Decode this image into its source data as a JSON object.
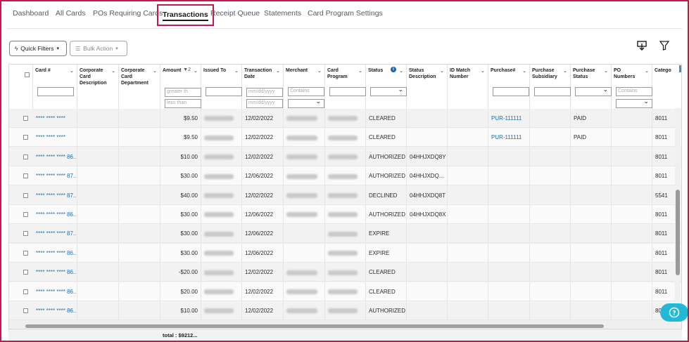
{
  "nav": {
    "tabs": [
      {
        "label": "Dashboard"
      },
      {
        "label": "All Cards"
      },
      {
        "label": "POs Requiring Cards"
      },
      {
        "label": "Transactions"
      },
      {
        "label": "Receipt Queue"
      },
      {
        "label": "Statements"
      },
      {
        "label": "Card Program Settings"
      }
    ],
    "active": "Transactions"
  },
  "toolbar": {
    "quick_filters": "Quick Filters",
    "bulk_action": "Bulk Action",
    "download_icon": "download-icon",
    "filter_icon": "filter-funnel-icon"
  },
  "columns": [
    {
      "label": "Card #",
      "filter": ""
    },
    {
      "label": "Corporate Card Description",
      "filter": ""
    },
    {
      "label": "Corporate Card Department",
      "filter": ""
    },
    {
      "label": "Amount",
      "filter_1": "greater th",
      "filter_2": "less than",
      "sort": "▼2"
    },
    {
      "label": "Issued To",
      "filter": ""
    },
    {
      "label": "Transaction Date",
      "filter_1": "mm/dd/yyyy",
      "filter_2": "mm/dd/yyyy"
    },
    {
      "label": "Merchant",
      "filter": "Contains"
    },
    {
      "label": "Card Program",
      "filter": ""
    },
    {
      "label": "Status",
      "filter": ""
    },
    {
      "label": "Status Description",
      "filter": ""
    },
    {
      "label": "ID Match Number",
      "filter": ""
    },
    {
      "label": "Purchase#",
      "filter": ""
    },
    {
      "label": "Purchase Subsidiary",
      "filter": ""
    },
    {
      "label": "Purchase Status",
      "filter": ""
    },
    {
      "label": "PO Numbers",
      "filter": "Contains"
    },
    {
      "label": "Catego",
      "filter": ""
    }
  ],
  "rows": [
    {
      "card": "**** **** ****",
      "amount": "$9.50",
      "date": "12/02/2022",
      "status": "CLEARED",
      "status_desc": "",
      "purchase": "PUR-111111",
      "purchase_status": "PAID",
      "category": "8011",
      "merchant": true
    },
    {
      "card": "**** **** ****",
      "amount": "$9.50",
      "date": "12/02/2022",
      "status": "CLEARED",
      "status_desc": "",
      "purchase": "PUR-111111",
      "purchase_status": "PAID",
      "category": "8011",
      "merchant": true
    },
    {
      "card": "**** **** **** 86...",
      "amount": "$10.00",
      "date": "12/02/2022",
      "status": "AUTHORIZED",
      "status_desc": "04HHJXDQ8Y",
      "purchase": "",
      "purchase_status": "",
      "category": "8011",
      "merchant": true
    },
    {
      "card": "**** **** **** 87...",
      "amount": "$30.00",
      "date": "12/06/2022",
      "status": "AUTHORIZED",
      "status_desc": "04HHJXDQ...",
      "purchase": "",
      "purchase_status": "",
      "category": "8011",
      "merchant": true
    },
    {
      "card": "**** **** **** 87...",
      "amount": "$40.00",
      "date": "12/02/2022",
      "status": "DECLINED",
      "status_desc": "04HHJXDQ8T",
      "purchase": "",
      "purchase_status": "",
      "category": "5541",
      "merchant": true
    },
    {
      "card": "**** **** **** 86...",
      "amount": "$30.00",
      "date": "12/06/2022",
      "status": "AUTHORIZED",
      "status_desc": "04HHJXDQ8X",
      "purchase": "",
      "purchase_status": "",
      "category": "8011",
      "merchant": true
    },
    {
      "card": "**** **** **** 87...",
      "amount": "$30.00",
      "date": "12/06/2022",
      "status": "EXPIRE",
      "status_desc": "",
      "purchase": "",
      "purchase_status": "",
      "category": "8011",
      "merchant": false
    },
    {
      "card": "**** **** **** 86...",
      "amount": "$30.00",
      "date": "12/06/2022",
      "status": "EXPIRE",
      "status_desc": "",
      "purchase": "",
      "purchase_status": "",
      "category": "8011",
      "merchant": false
    },
    {
      "card": "**** **** **** 86...",
      "amount": "-$20.00",
      "date": "12/02/2022",
      "status": "CLEARED",
      "status_desc": "",
      "purchase": "",
      "purchase_status": "",
      "category": "8011",
      "merchant": true
    },
    {
      "card": "**** **** **** 86...",
      "amount": "$20.00",
      "date": "12/02/2022",
      "status": "CLEARED",
      "status_desc": "",
      "purchase": "",
      "purchase_status": "",
      "category": "8011",
      "merchant": true
    },
    {
      "card": "**** **** **** 86...",
      "amount": "$10.00",
      "date": "12/02/2022",
      "status": "AUTHORIZED",
      "status_desc": "",
      "purchase": "",
      "purchase_status": "",
      "category": "80",
      "merchant": true
    }
  ],
  "footer": {
    "total": "total : $9212..."
  },
  "colors": {
    "accent": "#c4174c",
    "link": "#1f6fa8",
    "help": "#22b8d6"
  }
}
